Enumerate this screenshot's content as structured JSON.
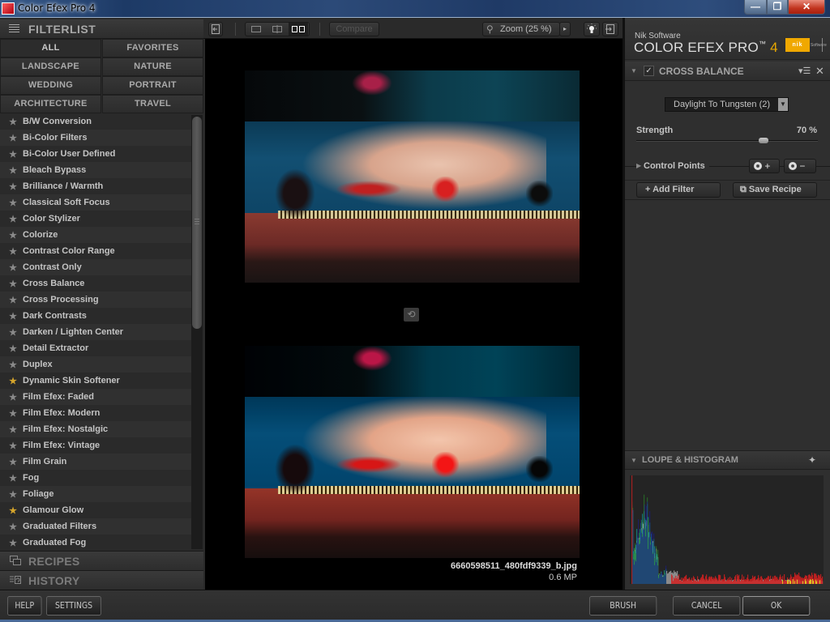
{
  "window": {
    "title": "Color Efex Pro 4",
    "controls": {
      "minimize": "—",
      "maximize": "❐",
      "close": "✕"
    }
  },
  "left_panel": {
    "filterlist_title": "FILTERLIST",
    "categories": [
      {
        "label": "ALL",
        "active": true
      },
      {
        "label": "FAVORITES",
        "active": false
      },
      {
        "label": "LANDSCAPE",
        "active": false
      },
      {
        "label": "NATURE",
        "active": false
      },
      {
        "label": "WEDDING",
        "active": false
      },
      {
        "label": "PORTRAIT",
        "active": false
      },
      {
        "label": "ARCHITECTURE",
        "active": false
      },
      {
        "label": "TRAVEL",
        "active": false
      }
    ],
    "filters": [
      {
        "label": "B/W Conversion",
        "favorite": false
      },
      {
        "label": "Bi-Color Filters",
        "favorite": false
      },
      {
        "label": "Bi-Color User Defined",
        "favorite": false
      },
      {
        "label": "Bleach Bypass",
        "favorite": false
      },
      {
        "label": "Brilliance / Warmth",
        "favorite": false
      },
      {
        "label": "Classical Soft Focus",
        "favorite": false
      },
      {
        "label": "Color Stylizer",
        "favorite": false
      },
      {
        "label": "Colorize",
        "favorite": false
      },
      {
        "label": "Contrast Color Range",
        "favorite": false
      },
      {
        "label": "Contrast Only",
        "favorite": false
      },
      {
        "label": "Cross Balance",
        "favorite": false
      },
      {
        "label": "Cross Processing",
        "favorite": false
      },
      {
        "label": "Dark Contrasts",
        "favorite": false
      },
      {
        "label": "Darken / Lighten Center",
        "favorite": false
      },
      {
        "label": "Detail Extractor",
        "favorite": false
      },
      {
        "label": "Duplex",
        "favorite": false
      },
      {
        "label": "Dynamic Skin Softener",
        "favorite": true
      },
      {
        "label": "Film Efex: Faded",
        "favorite": false
      },
      {
        "label": "Film Efex: Modern",
        "favorite": false
      },
      {
        "label": "Film Efex: Nostalgic",
        "favorite": false
      },
      {
        "label": "Film Efex: Vintage",
        "favorite": false
      },
      {
        "label": "Film Grain",
        "favorite": false
      },
      {
        "label": "Fog",
        "favorite": false
      },
      {
        "label": "Foliage",
        "favorite": false
      },
      {
        "label": "Glamour Glow",
        "favorite": true
      },
      {
        "label": "Graduated Filters",
        "favorite": false
      },
      {
        "label": "Graduated Fog",
        "favorite": false
      }
    ],
    "star_glyph": "★",
    "recipes_label": "RECIPES",
    "history_label": "HISTORY"
  },
  "toolbar": {
    "compare_label": "Compare",
    "zoom_label": "Zoom (25 %)",
    "zoom_arrow": "▸",
    "search_glyph": "⚲"
  },
  "preview": {
    "file_name": "6660598511_480fdf9339_b.jpg",
    "file_size": "0.6 MP",
    "swap_glyph": "⟲"
  },
  "right_panel": {
    "brand_company": "Nik Software",
    "brand_product": "COLOR EFEX PRO",
    "brand_tm": "™",
    "brand_version": "4",
    "nik_logo": "nik",
    "nik_logo_text": "Software",
    "filter": {
      "title": "CROSS BALANCE",
      "enabled": true,
      "check_glyph": "✓",
      "collapse_glyph": "▼",
      "menu_glyph": "▾☰",
      "close_glyph": "✕",
      "preset": "Daylight To Tungsten (2)",
      "preset_arrow": "▼",
      "strength_label": "Strength",
      "strength_value": 70,
      "strength_display": "70  %",
      "control_points_label": "Control Points",
      "control_points_expand": "▶",
      "cp_add_glyph": "+",
      "cp_remove_glyph": "−"
    },
    "add_filter_label": "+  Add Filter",
    "save_recipe_label": "⧉  Save Recipe",
    "loupe_title": "LOUPE & HISTOGRAM",
    "loupe_collapse": "▼",
    "loupe_pin": "✦"
  },
  "bottom_bar": {
    "help": "HELP",
    "settings": "SETTINGS",
    "brush": "BRUSH",
    "cancel": "CANCEL",
    "ok": "OK"
  }
}
